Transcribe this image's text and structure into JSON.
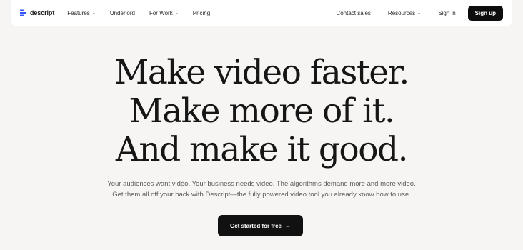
{
  "nav": {
    "brand": "descript",
    "left_items": [
      {
        "label": "Features",
        "has_dropdown": true
      },
      {
        "label": "Underlord",
        "has_dropdown": false
      },
      {
        "label": "For Work",
        "has_dropdown": true
      },
      {
        "label": "Pricing",
        "has_dropdown": false
      }
    ],
    "right_items": [
      {
        "label": "Contact sales",
        "has_dropdown": false
      },
      {
        "label": "Resources",
        "has_dropdown": true
      },
      {
        "label": "Sign in",
        "has_dropdown": false
      }
    ],
    "signup_label": "Sign up",
    "brand_color": "#3a55f5"
  },
  "hero": {
    "headline": [
      "Make video faster.",
      "Make more of it.",
      "And make it good."
    ],
    "subtext": [
      "Your audiences want video. Your business needs video. The algorithms demand more and more video.",
      "Get them all off your back with Descript—the fully powered video tool you already know how to use."
    ],
    "cta_label": "Get started for free",
    "cta_arrow": "→"
  },
  "icons": {
    "logo": "descript-logo-icon",
    "dropdown": "chevron-down-icon",
    "cta": "arrow-right-icon"
  }
}
